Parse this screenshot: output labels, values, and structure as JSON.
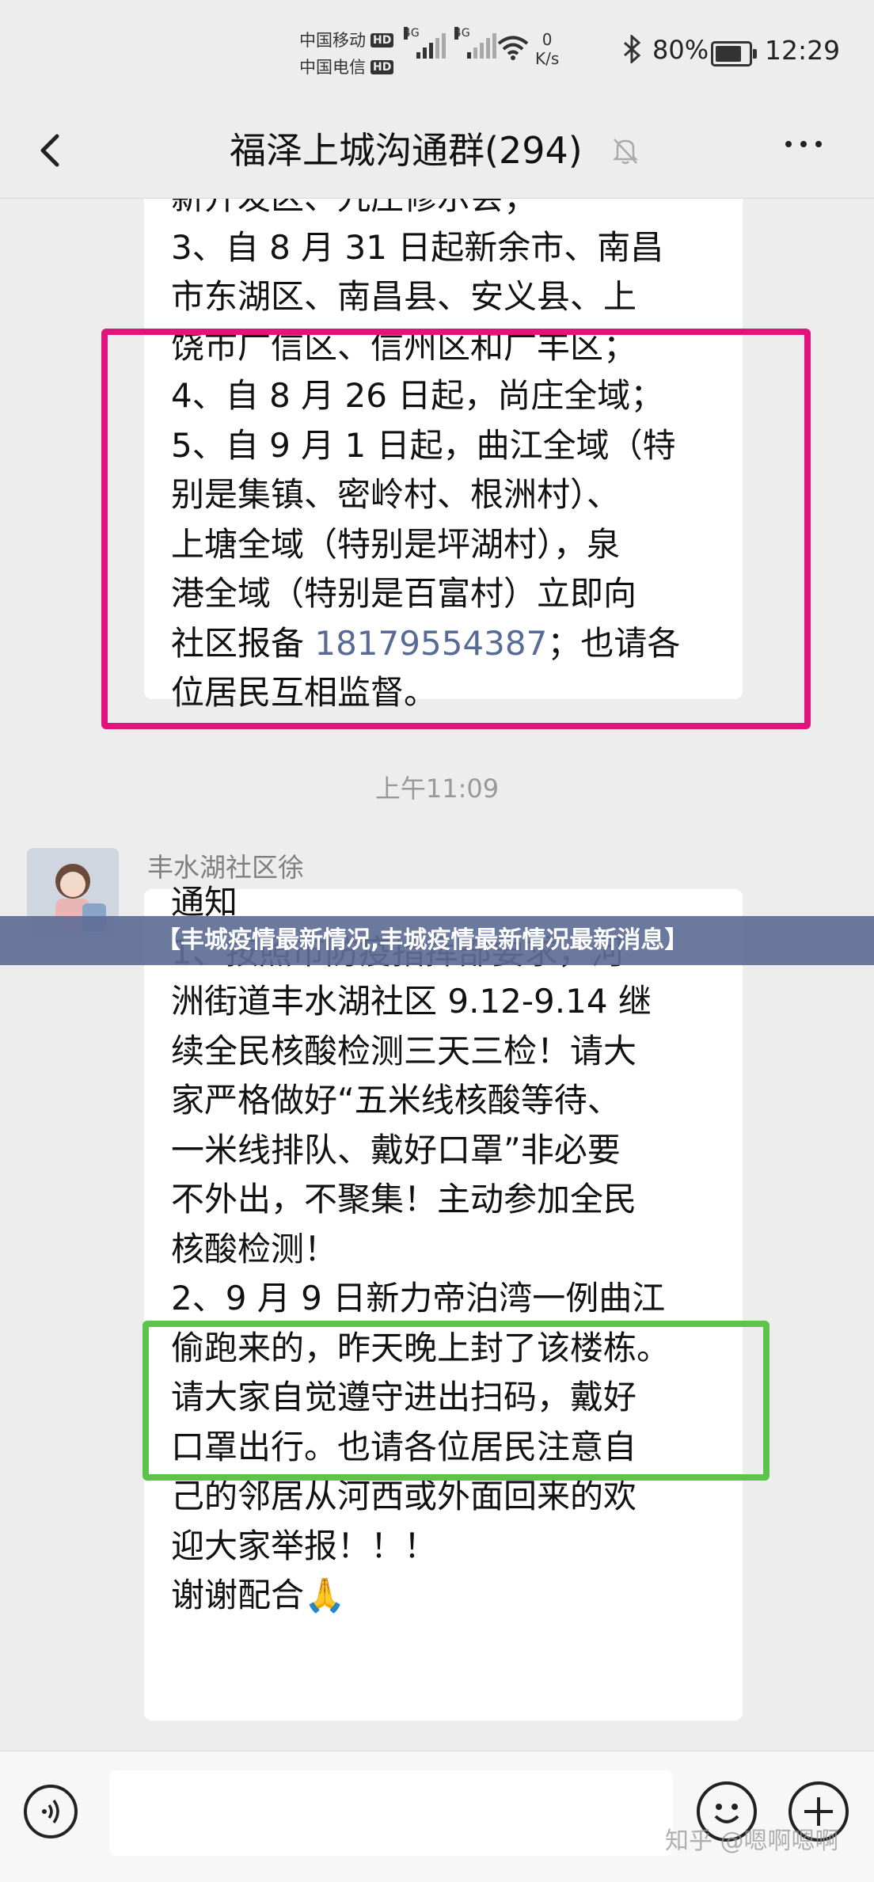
{
  "status_bar": {
    "carrier_1": "中国移动",
    "carrier_2": "中国电信",
    "hd": "HD",
    "network": "4G",
    "speed_value": "0",
    "speed_unit": "K/s",
    "battery": "80%",
    "time": "12:29"
  },
  "nav": {
    "title": "福泽上城沟通群(294)"
  },
  "messages": {
    "first": {
      "lines": [
        "新开发区、九庄修示会；",
        "3、自 8 月 31 日起新余市、南昌",
        "市东湖区、南昌县、安义县、上",
        "饶市广信区、信州区和广丰区；",
        "4、自 8 月 26 日起，尚庄全域；",
        "5、自 9 月 1 日起，曲江全域（特",
        "别是集镇、密岭村、根洲村）、",
        "上塘全域（特别是坪湖村），泉",
        "港全域（特别是百富村）立即向"
      ],
      "line_pre": "社区报备 ",
      "phone": "18179554387",
      "line_post": "；也请各",
      "last_line": "位居民互相监督。"
    },
    "timestamp": "上午11:09",
    "sender": "丰水湖社区徐",
    "second": {
      "lines": [
        "通知",
        "",
        "1、按照市防疫指挥部要求，河",
        "洲街道丰水湖社区 9.12-9.14 继",
        "续全民核酸检测三天三检！请大",
        "家严格做好“五米线核酸等待、",
        "一米线排队、戴好口罩”非必要",
        "不外出，不聚集！主动参加全民",
        "核酸检测！",
        "2、9 月 9 日新力帝泊湾一例曲江",
        "偷跑来的，昨天晚上封了该楼栋。",
        "请大家自觉遵守进出扫码，戴好",
        "口罩出行。也请各位居民注意自",
        "己的邻居从河西或外面回来的欢",
        "迎大家举报！！！",
        "谢谢配合🙏"
      ]
    }
  },
  "banner": {
    "text": "【丰城疫情最新情况,丰城疫情最新情况最新消息】"
  },
  "watermark": "知乎 @嗯啊嗯啊",
  "colors": {
    "highlight_pink": "#e0147a",
    "highlight_green": "#5cc44a",
    "link": "#576b95",
    "banner": "#5f6e96"
  },
  "icons": [
    "back-arrow-icon",
    "mute-bell-icon",
    "more-dots-icon",
    "voice-icon",
    "emoji-icon",
    "plus-icon",
    "wifi-icon",
    "bluetooth-icon",
    "battery-icon",
    "signal-icon"
  ]
}
